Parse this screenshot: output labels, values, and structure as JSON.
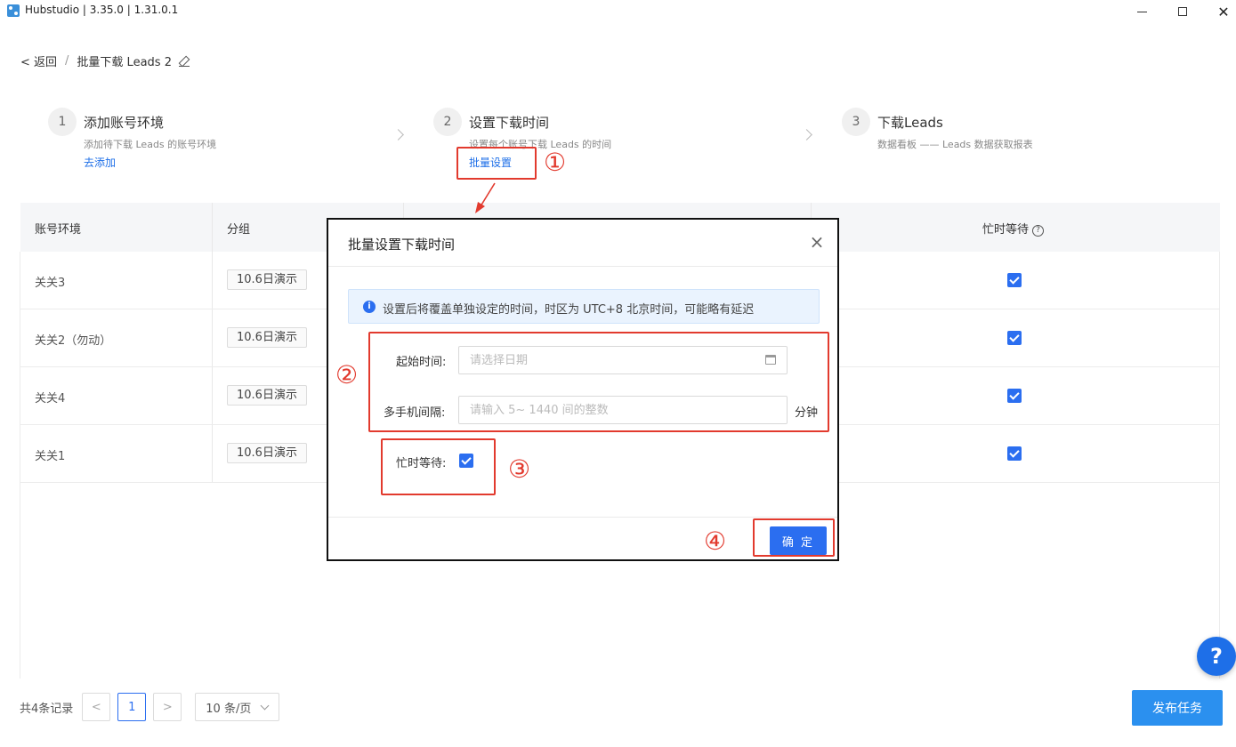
{
  "window": {
    "title": "Hubstudio | 3.35.0 | 1.31.0.1"
  },
  "breadcrumb": {
    "back": "< 返回",
    "separator": "/",
    "current": "批量下载 Leads 2"
  },
  "steps": [
    {
      "num": "1",
      "title": "添加账号环境",
      "desc": "添加待下载 Leads 的账号环境",
      "link": "去添加"
    },
    {
      "num": "2",
      "title": "设置下载时间",
      "desc": "设置每个账号下载 Leads 的时间",
      "link": "批量设置"
    },
    {
      "num": "3",
      "title": "下载Leads",
      "desc": "数据看板 —— Leads 数据获取报表"
    }
  ],
  "table": {
    "headers": {
      "account": "账号环境",
      "group": "分组",
      "busy_wait": "忙时等待"
    },
    "rows": [
      {
        "account": "关关3",
        "group": "10.6日演示",
        "busy_wait": true
      },
      {
        "account": "关关2（勿动）",
        "group": "10.6日演示",
        "busy_wait": true
      },
      {
        "account": "关关4",
        "group": "10.6日演示",
        "busy_wait": true
      },
      {
        "account": "关关1",
        "group": "10.6日演示",
        "busy_wait": true
      }
    ]
  },
  "pagination": {
    "total": "共4条记录",
    "prev": "<",
    "current_page": "1",
    "next": ">",
    "page_size": "10 条/页"
  },
  "actions": {
    "publish": "发布任务",
    "help": "?"
  },
  "modal": {
    "title": "批量设置下载时间",
    "close": "×",
    "alert": "设置后将覆盖单独设定的时间，时区为 UTC+8 北京时间，可能略有延迟",
    "start_time_label": "起始时间:",
    "start_time_placeholder": "请选择日期",
    "interval_label": "多手机间隔:",
    "interval_placeholder": "请输入 5~ 1440 间的整数",
    "interval_unit": "分钟",
    "busy_wait_label": "忙时等待:",
    "busy_wait_checked": true,
    "confirm": "确 定"
  },
  "annotations": [
    "①",
    "②",
    "③",
    "④"
  ],
  "colors": {
    "accent": "#2b6ef0",
    "annotation": "#e23a2e",
    "publish": "#2b90ef"
  }
}
